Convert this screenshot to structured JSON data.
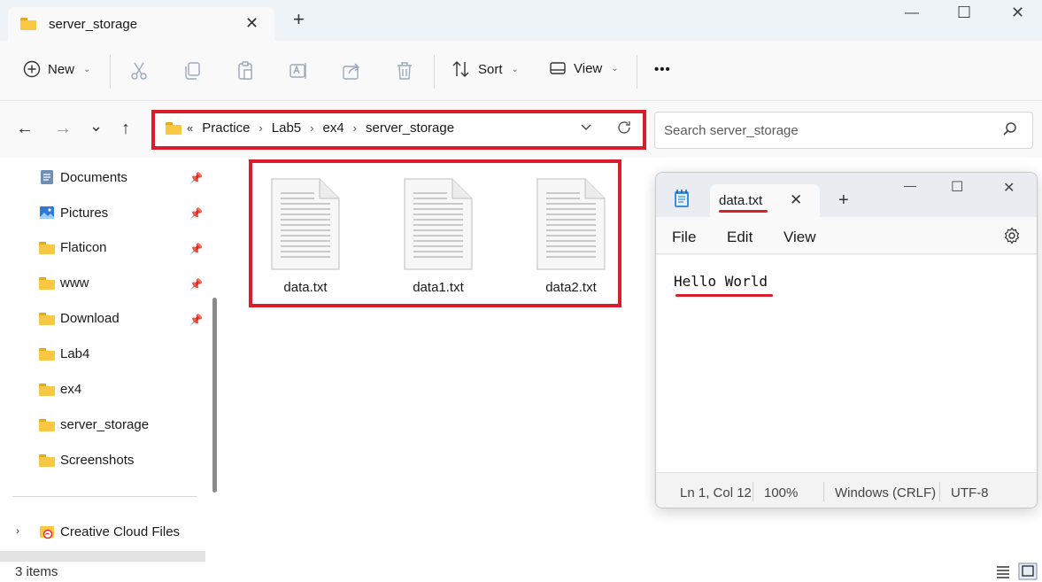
{
  "explorer": {
    "tab_title": "server_storage",
    "tab_close": "✕",
    "new_tab": "+",
    "window_controls": {
      "minimize": "—",
      "maximize": "☐",
      "close": "✕"
    },
    "command_bar": {
      "new_label": "New",
      "sort_label": "Sort",
      "view_label": "View",
      "more_label": "•••",
      "icons": [
        "cut-icon",
        "copy-icon",
        "paste-icon",
        "rename-icon",
        "share-icon",
        "delete-icon"
      ]
    },
    "nav": {
      "back": "←",
      "forward": "→",
      "recent": "⌄",
      "up": "↑"
    },
    "address": {
      "overflow": "«",
      "crumbs": [
        "Practice",
        "Lab5",
        "ex4",
        "server_storage"
      ],
      "separator": "›"
    },
    "search": {
      "placeholder": "Search server_storage"
    },
    "sidebar": {
      "items": [
        {
          "label": "Documents",
          "icon": "documents-icon",
          "pinned": true
        },
        {
          "label": "Pictures",
          "icon": "pictures-icon",
          "pinned": true
        },
        {
          "label": "Flaticon",
          "icon": "folder-icon",
          "pinned": true
        },
        {
          "label": "www",
          "icon": "folder-icon",
          "pinned": true
        },
        {
          "label": "Download",
          "icon": "folder-icon",
          "pinned": true
        },
        {
          "label": "Lab4",
          "icon": "folder-icon",
          "pinned": false
        },
        {
          "label": "ex4",
          "icon": "folder-icon",
          "pinned": false
        },
        {
          "label": "server_storage",
          "icon": "folder-icon",
          "pinned": false
        },
        {
          "label": "Screenshots",
          "icon": "folder-icon",
          "pinned": false
        }
      ],
      "cloud": {
        "label": "Creative Cloud Files",
        "expand": "›"
      }
    },
    "files": [
      {
        "name": "data.txt"
      },
      {
        "name": "data1.txt"
      },
      {
        "name": "data2.txt"
      }
    ],
    "status": {
      "item_count": "3 items"
    }
  },
  "notepad": {
    "tab_title": "data.txt",
    "tab_close": "✕",
    "new_tab": "+",
    "window_controls": {
      "minimize": "—",
      "maximize": "☐",
      "close": "✕"
    },
    "menu": {
      "file": "File",
      "edit": "Edit",
      "view": "View"
    },
    "content": "Hello World",
    "status": {
      "position": "Ln 1, Col 12",
      "zoom": "100%",
      "line_ending": "Windows (CRLF)",
      "encoding": "UTF-8"
    }
  },
  "colors": {
    "highlight_red": "#d81e2b",
    "folder_yellow": "#f8c842",
    "titlebar": "#eef3f8"
  }
}
